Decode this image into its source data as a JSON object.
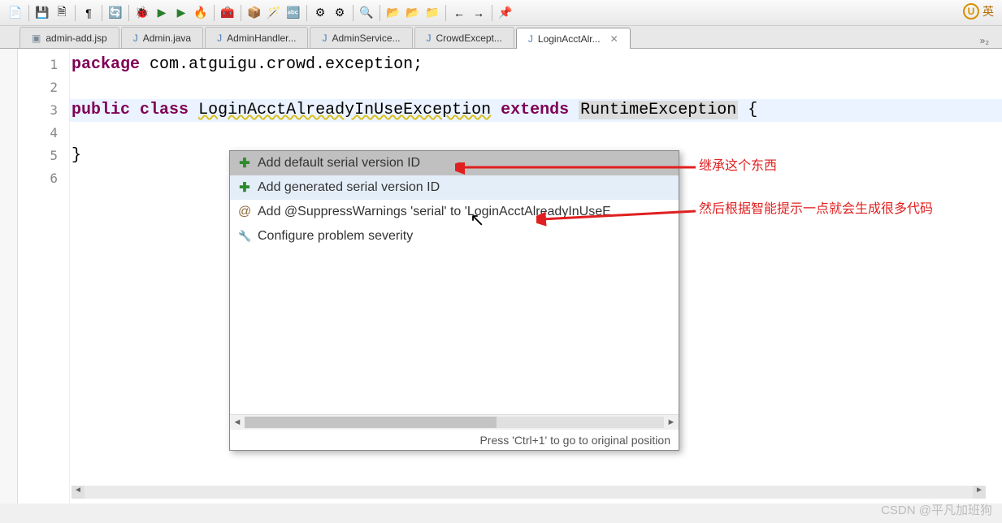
{
  "ime": {
    "symbol": "U",
    "label": "英"
  },
  "tabs": [
    {
      "icon": "jsp",
      "label": "admin-add.jsp"
    },
    {
      "icon": "java",
      "label": "Admin.java"
    },
    {
      "icon": "java",
      "label": "AdminHandler..."
    },
    {
      "icon": "java",
      "label": "AdminService..."
    },
    {
      "icon": "java",
      "label": "CrowdExcept..."
    },
    {
      "icon": "java",
      "label": "LoginAcctAlr...",
      "active": true
    }
  ],
  "overflow": "»₂",
  "code": {
    "l1_kw": "package",
    "l1_rest": " com.atguigu.crowd.exception;",
    "l3_kw1": "public",
    "l3_kw2": "class",
    "l3_cls": "LoginAcctAlreadyInUseException",
    "l3_kw3": "extends",
    "l3_ext": "RuntimeException",
    "l3_brace": " {",
    "l5": "}"
  },
  "lines": [
    "1",
    "2",
    "3",
    "4",
    "5",
    "6"
  ],
  "quickfix": {
    "items": [
      {
        "icon": "plus",
        "label": "Add default serial version ID",
        "state": "selected"
      },
      {
        "icon": "plus",
        "label": "Add generated serial version ID",
        "state": "hover"
      },
      {
        "icon": "at",
        "label": "Add @SuppressWarnings 'serial' to 'LoginAcctAlreadyInUseE",
        "state": ""
      },
      {
        "icon": "cfg",
        "label": "Configure problem severity",
        "state": ""
      }
    ],
    "hint": "Press 'Ctrl+1' to go to original position"
  },
  "annotations": {
    "a1": "继承这个东西",
    "a2": "然后根据智能提示一点就会生成很多代码"
  },
  "watermark": "CSDN @平凡加班狗"
}
